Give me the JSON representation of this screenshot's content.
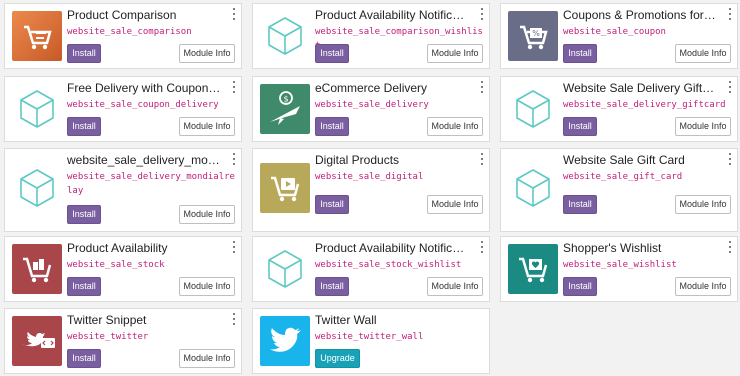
{
  "colors": {
    "install": "#7a5fa0",
    "upgrade": "#17a2b8",
    "tech_name": "#c0217a",
    "generic_cube": "#5ec9c2"
  },
  "labels": {
    "install": "Install",
    "upgrade": "Upgrade",
    "module_info": "Module Info"
  },
  "modules": [
    {
      "title": "Product Comparison",
      "tech": "website_sale_comparison",
      "action": "Install",
      "icon": "product-comparison-icon"
    },
    {
      "title": "Product Availability Notifications",
      "tech": "website_sale_comparison_wishlist",
      "action": "Install",
      "icon": "generic-module-cube-icon"
    },
    {
      "title": "Coupons & Promotions for eC…",
      "tech": "website_sale_coupon",
      "action": "Install",
      "icon": "coupon-icon"
    },
    {
      "title": "Free Delivery with Coupon on …",
      "tech": "website_sale_coupon_delivery",
      "action": "Install",
      "icon": "generic-module-cube-icon"
    },
    {
      "title": "eCommerce Delivery",
      "tech": "website_sale_delivery",
      "action": "Install",
      "icon": "delivery-plane-icon"
    },
    {
      "title": "Website Sale Delivery Giftcard",
      "tech": "website_sale_delivery_giftcard",
      "action": "Install",
      "icon": "generic-module-cube-icon"
    },
    {
      "title": "website_sale_delivery_mondial…",
      "tech": "website_sale_delivery_mondialrelay",
      "action": "Install",
      "icon": "generic-module-cube-icon"
    },
    {
      "title": "Digital Products",
      "tech": "website_sale_digital",
      "action": "Install",
      "icon": "digital-products-icon"
    },
    {
      "title": "Website Sale Gift Card",
      "tech": "website_sale_gift_card",
      "action": "Install",
      "icon": "generic-module-cube-icon"
    },
    {
      "title": "Product Availability",
      "tech": "website_sale_stock",
      "action": "Install",
      "icon": "stock-cart-icon"
    },
    {
      "title": "Product Availability Notifications",
      "tech": "website_sale_stock_wishlist",
      "action": "Install",
      "icon": "generic-module-cube-icon"
    },
    {
      "title": "Shopper's Wishlist",
      "tech": "website_sale_wishlist",
      "action": "Install",
      "icon": "wishlist-cart-icon"
    },
    {
      "title": "Twitter Snippet",
      "tech": "website_twitter",
      "action": "Install",
      "icon": "twitter-snippet-icon"
    },
    {
      "title": "Twitter Wall",
      "tech": "website_twitter_wall",
      "action": "Upgrade",
      "icon": "twitter-bird-icon"
    }
  ]
}
